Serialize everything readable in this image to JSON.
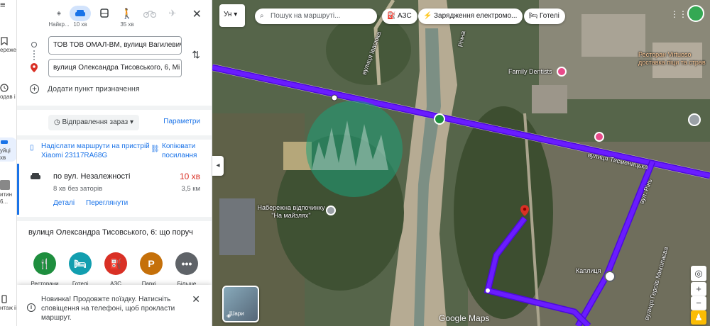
{
  "rail": {
    "items": [
      {
        "label": "ережені"
      },
      {
        "label": "одав і"
      },
      {
        "label": "уйці хв"
      },
      {
        "label": "итин 6..."
      },
      {
        "label": "нтаж ії"
      }
    ]
  },
  "modes": [
    {
      "label": "Найкр...",
      "icon": "diamond-route-icon",
      "active": false
    },
    {
      "label": "10 хв",
      "icon": "car-icon",
      "active": true
    },
    {
      "label": "",
      "icon": "bus-icon",
      "active": false
    },
    {
      "label": "35 хв",
      "icon": "walk-icon",
      "active": false
    },
    {
      "label": "",
      "icon": "bike-icon",
      "active": false
    },
    {
      "label": "",
      "icon": "plane-icon",
      "active": false
    }
  ],
  "origin": "ТОВ ТОВ ОМАЛ-ВМ, вулиця Вагилевич",
  "destination": "вулиця Олександра Тисовського, 6, Мі",
  "add_destination": "Додати пункт призначення",
  "depart": "Відправлення зараз",
  "params": "Параметри",
  "send": "Надіслати маршрути на пристрій Xiaomi 23117RA68G",
  "copy": "Копіювати посилання",
  "route": {
    "name": "по вул. Незалежності",
    "time": "10 хв",
    "sub": "8 хв без заторів",
    "dist": "3,5 км",
    "details": "Деталі",
    "send": "Переглянути"
  },
  "nearby_title": "вулиця Олександра Тисовського, 6: що поруч",
  "nearby": [
    {
      "label": "Ресторани",
      "icon": "fork-knife-icon",
      "color": "#1e8e3e"
    },
    {
      "label": "Готелі",
      "icon": "bed-icon",
      "color": "#129eaf"
    },
    {
      "label": "АЗС",
      "icon": "gas-icon",
      "color": "#d93025"
    },
    {
      "label": "Паркі...",
      "icon": "parking-icon",
      "color": "#c5700a"
    },
    {
      "label": "Більше",
      "icon": "more-icon",
      "color": "#5f6368"
    }
  ],
  "toast": "Новинка! Продовжте поїздку. Натисніть сповіщення на телефоні, щоб прокласти маршрут.",
  "map": {
    "lang": "Ун",
    "search_placeholder": "Пошук на маршруті...",
    "chips": [
      {
        "label": "АЗС",
        "icon": "gas-icon"
      },
      {
        "label": "Зарядження електромо...",
        "icon": "ev-charge-icon"
      },
      {
        "label": "Готелі",
        "icon": "bed-icon"
      }
    ],
    "labels": {
      "street_main": "вулиця Тисменицька",
      "street_ivasyuka": "вулиця Івасюка",
      "street_rinh": "вул. Рінь",
      "street_heroes": "вулиця Героїв Миколаєва",
      "church": "Каплиця",
      "restaurant": "Ресторан Virtuoso доставка піци та страв",
      "dentist": "Family Dentists",
      "embankment": "Набережна відпочинку \"На майзлях\"",
      "river_road": "Річна",
      "google": "Google Maps",
      "layers": "Шари"
    },
    "route_color": "#6a1cff"
  }
}
